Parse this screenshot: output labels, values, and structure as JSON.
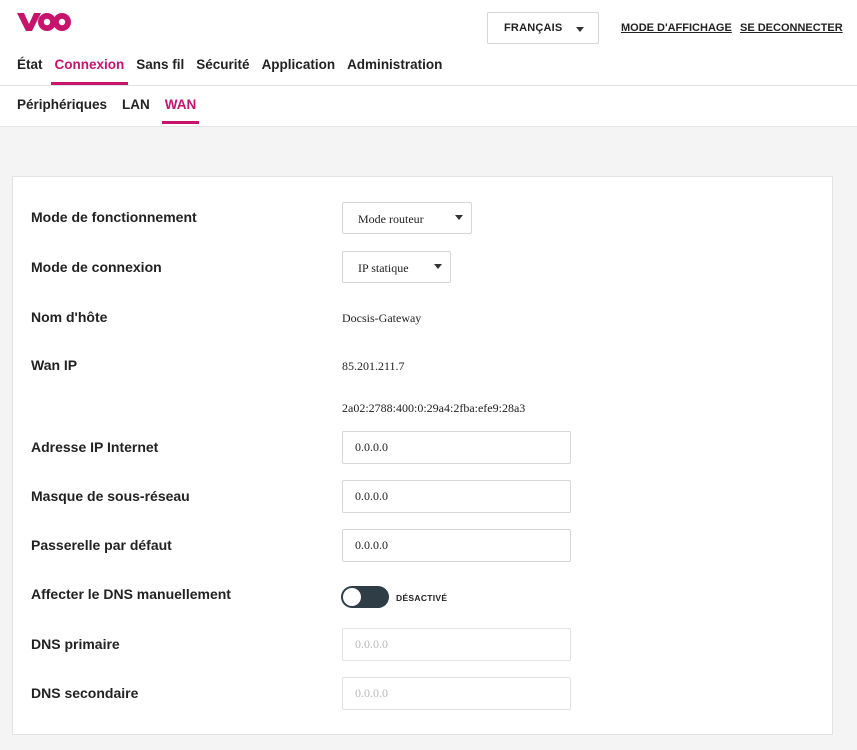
{
  "brand": {
    "logo_text": "voo",
    "accent": "#c8136c"
  },
  "header": {
    "language": "FRANÇAIS",
    "display_mode": "MODE D'AFFICHAGE",
    "logout": "SE DECONNECTER"
  },
  "main_nav": [
    {
      "label": "État",
      "active": false
    },
    {
      "label": "Connexion",
      "active": true
    },
    {
      "label": "Sans fil",
      "active": false
    },
    {
      "label": "Sécurité",
      "active": false
    },
    {
      "label": "Application",
      "active": false
    },
    {
      "label": "Administration",
      "active": false
    }
  ],
  "sub_nav": [
    {
      "label": "Périphériques",
      "active": false
    },
    {
      "label": "LAN",
      "active": false
    },
    {
      "label": "WAN",
      "active": true
    }
  ],
  "form": {
    "operation_mode": {
      "label": "Mode de fonctionnement",
      "value": "Mode routeur"
    },
    "connection_mode": {
      "label": "Mode de connexion",
      "value": "IP statique"
    },
    "hostname": {
      "label": "Nom d'hôte",
      "value": "Docsis-Gateway"
    },
    "wan_ip": {
      "label": "Wan IP",
      "ipv4": "85.201.211.7",
      "ipv6": "2a02:2788:400:0:29a4:2fba:efe9:28a3"
    },
    "internet_ip": {
      "label": "Adresse IP Internet",
      "value": "0.0.0.0"
    },
    "subnet_mask": {
      "label": "Masque de sous-réseau",
      "value": "0.0.0.0"
    },
    "gateway": {
      "label": "Passerelle par défaut",
      "value": "0.0.0.0"
    },
    "manual_dns": {
      "label": "Affecter le DNS manuellement",
      "state": "DÉSACTIVÉ"
    },
    "dns_primary": {
      "label": "DNS primaire",
      "placeholder": "0.0.0.0"
    },
    "dns_secondary": {
      "label": "DNS secondaire",
      "placeholder": "0.0.0.0"
    }
  }
}
